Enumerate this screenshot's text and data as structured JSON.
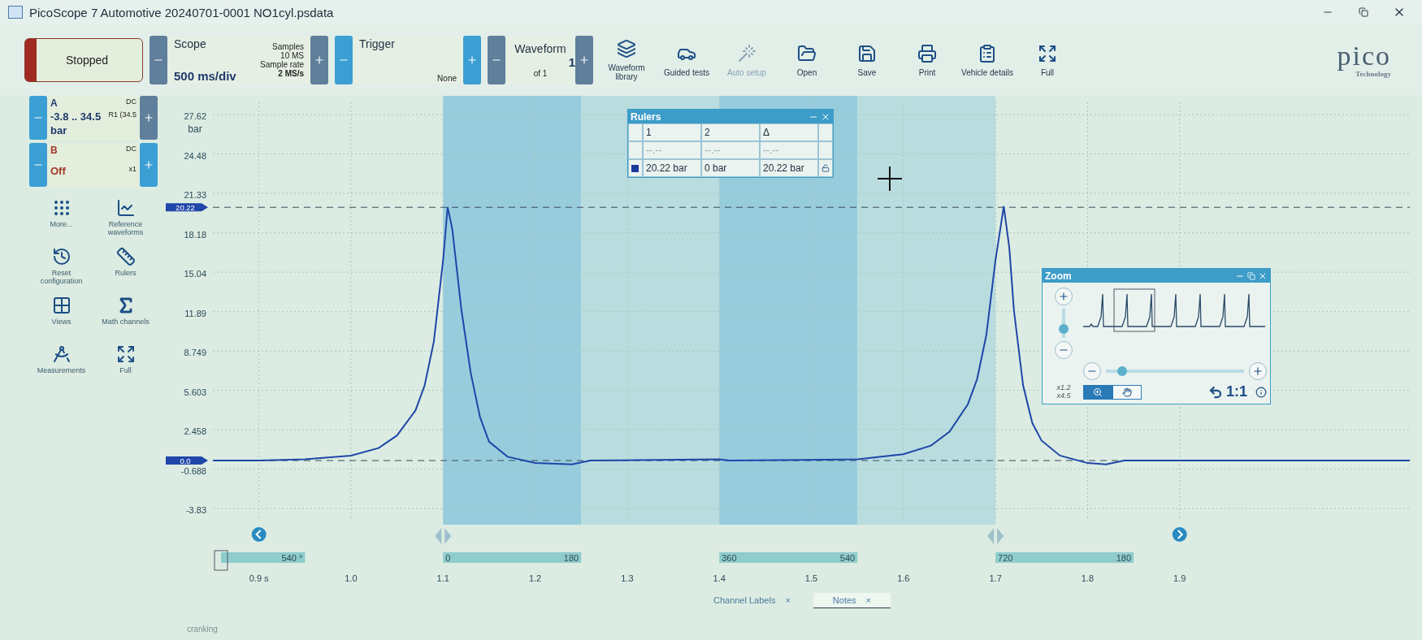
{
  "window": {
    "title": "PicoScope 7 Automotive 20240701-0001 NO1cyl.psdata"
  },
  "toolbar": {
    "run_button": {
      "label": "Stopped",
      "running": false
    },
    "scope": {
      "title": "Scope",
      "timebase": "500 ms/div",
      "samples_label": "Samples",
      "samples": "10 MS",
      "rate_label": "Sample rate",
      "rate": "2 MS/s"
    },
    "trigger": {
      "title": "Trigger",
      "mode": "None"
    },
    "waveform": {
      "title": "Waveform",
      "index": "1",
      "count": "of 1"
    },
    "tools": [
      {
        "label": "Waveform library",
        "kind": "library",
        "disabled": false
      },
      {
        "label": "Guided tests",
        "kind": "car",
        "disabled": false
      },
      {
        "label": "Auto setup",
        "kind": "wand",
        "disabled": true
      },
      {
        "label": "Open",
        "kind": "open",
        "disabled": false
      },
      {
        "label": "Save",
        "kind": "save",
        "disabled": false
      },
      {
        "label": "Print",
        "kind": "print",
        "disabled": false
      },
      {
        "label": "Vehicle details",
        "kind": "clipboard",
        "disabled": false
      },
      {
        "label": "Full",
        "kind": "full",
        "disabled": false
      }
    ]
  },
  "logo": {
    "name": "pico",
    "tagline": "Technology"
  },
  "channels": [
    {
      "name": "A",
      "coupling": "DC",
      "range": "-3.8 .. 34.5",
      "probe": "R1 (34.5",
      "unit": "bar",
      "enabled": true
    },
    {
      "name": "B",
      "coupling": "DC",
      "range": "Off",
      "probe": "x1",
      "enabled": false
    }
  ],
  "side_tools": [
    {
      "label": "More...",
      "kind": "dots"
    },
    {
      "label": "Reference waveforms",
      "kind": "chart"
    },
    {
      "label": "Reset configuration",
      "kind": "history"
    },
    {
      "label": "Rulers",
      "kind": "ruler"
    },
    {
      "label": "Views",
      "kind": "grid"
    },
    {
      "label": "Math channels",
      "kind": "sigma"
    },
    {
      "label": "Measurements",
      "kind": "compass"
    },
    {
      "label": "Full",
      "kind": "expand"
    }
  ],
  "chart": {
    "chart_data": {
      "type": "line",
      "ylabel": "bar",
      "grid": true,
      "x": [
        0.85,
        0.9,
        0.95,
        1.0,
        1.03,
        1.05,
        1.07,
        1.08,
        1.09,
        1.1,
        1.105,
        1.11,
        1.12,
        1.13,
        1.14,
        1.15,
        1.17,
        1.2,
        1.24,
        1.26,
        1.4,
        1.41,
        1.55,
        1.6,
        1.63,
        1.65,
        1.67,
        1.68,
        1.69,
        1.7,
        1.709,
        1.715,
        1.72,
        1.73,
        1.74,
        1.75,
        1.77,
        1.8,
        1.82,
        1.84,
        1.99,
        2.15
      ],
      "series": [
        {
          "color": "#1f46a8",
          "values": [
            0.0,
            0.0,
            0.1,
            0.4,
            1.0,
            2.0,
            4.0,
            6.0,
            9.5,
            16.0,
            20.22,
            18.5,
            12.0,
            7.0,
            3.5,
            1.5,
            0.3,
            -0.2,
            -0.3,
            0.0,
            0.1,
            0.0,
            0.1,
            0.5,
            1.2,
            2.3,
            4.5,
            6.5,
            10.0,
            16.0,
            20.3,
            17.0,
            12.0,
            6.0,
            3.0,
            1.6,
            0.4,
            -0.2,
            -0.3,
            0.0,
            0.0,
            0.0
          ]
        }
      ],
      "xlim": [
        0.85,
        2.15
      ],
      "ylim": [
        -4.6,
        28.6
      ],
      "xticks": [
        {
          "value": 0.9,
          "label": "0.9 s"
        },
        {
          "value": 1.0,
          "label": "1.0"
        },
        {
          "value": 1.1,
          "label": "1.1"
        },
        {
          "value": 1.2,
          "label": "1.2"
        },
        {
          "value": 1.3,
          "label": "1.3"
        },
        {
          "value": 1.4,
          "label": "1.4"
        },
        {
          "value": 1.5,
          "label": "1.5"
        },
        {
          "value": 1.6,
          "label": "1.6"
        },
        {
          "value": 1.7,
          "label": "1.7"
        },
        {
          "value": 1.8,
          "label": "1.8"
        },
        {
          "value": 1.9,
          "label": "1.9"
        }
      ],
      "yticks": [
        27.62,
        24.48,
        21.33,
        18.18,
        15.04,
        11.89,
        8.749,
        5.603,
        2.458,
        -0.688,
        {
          "value": -3.834,
          "label": "-3.83"
        }
      ],
      "ref_lines": [
        {
          "axis": "y",
          "value": 20.22,
          "label": "20.22"
        },
        {
          "axis": "y",
          "value": 0,
          "label": "0.0"
        }
      ]
    },
    "crank_marks": [
      {
        "label": "540 °",
        "kind": "plain"
      },
      {
        "label": "0",
        "kind": "dark"
      },
      {
        "label": "180",
        "kind": "light"
      },
      {
        "label": "360",
        "kind": "dark"
      },
      {
        "label": "540",
        "kind": "light"
      },
      {
        "label": "720",
        "kind": "plain"
      },
      {
        "label": "180",
        "kind": "plain"
      }
    ]
  },
  "rulers_window": {
    "title": "Rulers",
    "columns": [
      "1",
      "2",
      "Δ"
    ],
    "rows": [
      {
        "kind": "time",
        "values": [
          "--.--",
          "--.--",
          "--.--"
        ]
      },
      {
        "kind": "channel",
        "color": "#1a3a9c",
        "values": [
          "20.22 bar",
          "0 bar",
          "20.22 bar"
        ]
      }
    ]
  },
  "zoom_window": {
    "title": "Zoom",
    "vertical_slider": {
      "level": 0.3
    },
    "horizontal_slider": {
      "level": 0.12
    },
    "scale_x": "x1.2",
    "scale_y": "x4.5",
    "tools": [
      {
        "kind": "zoom",
        "selected": true
      },
      {
        "kind": "pan",
        "selected": false
      }
    ],
    "reset": "1:1"
  },
  "bottom_tabs": [
    {
      "label": "Channel Labels",
      "close": "×",
      "selected": false
    },
    {
      "label": "Notes",
      "close": "×",
      "selected": true
    }
  ],
  "footer_note": "cranking"
}
